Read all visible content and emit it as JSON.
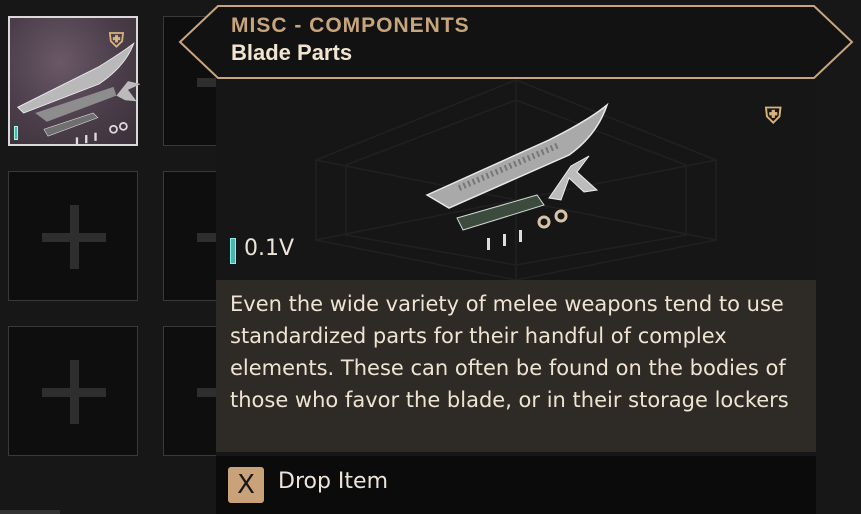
{
  "tooltip": {
    "category": "MISC - COMPONENTS",
    "item_name": "Blade Parts",
    "weight": "0.1V",
    "description": "Even the wide variety of melee weapons tend to use standardized parts for their handful of complex elements. These can often be found on the bodies of those who favor the blade, or in their storage lockers",
    "item_icon": "blade-parts-icon",
    "badge_icon": "horseshoe-badge-icon"
  },
  "actions": {
    "drop_key": "X",
    "drop_label": "Drop Item"
  },
  "colors": {
    "accent_gold": "#c7a57d",
    "weight_teal": "#4ab3ac",
    "description_bg": "#2e2a26"
  }
}
